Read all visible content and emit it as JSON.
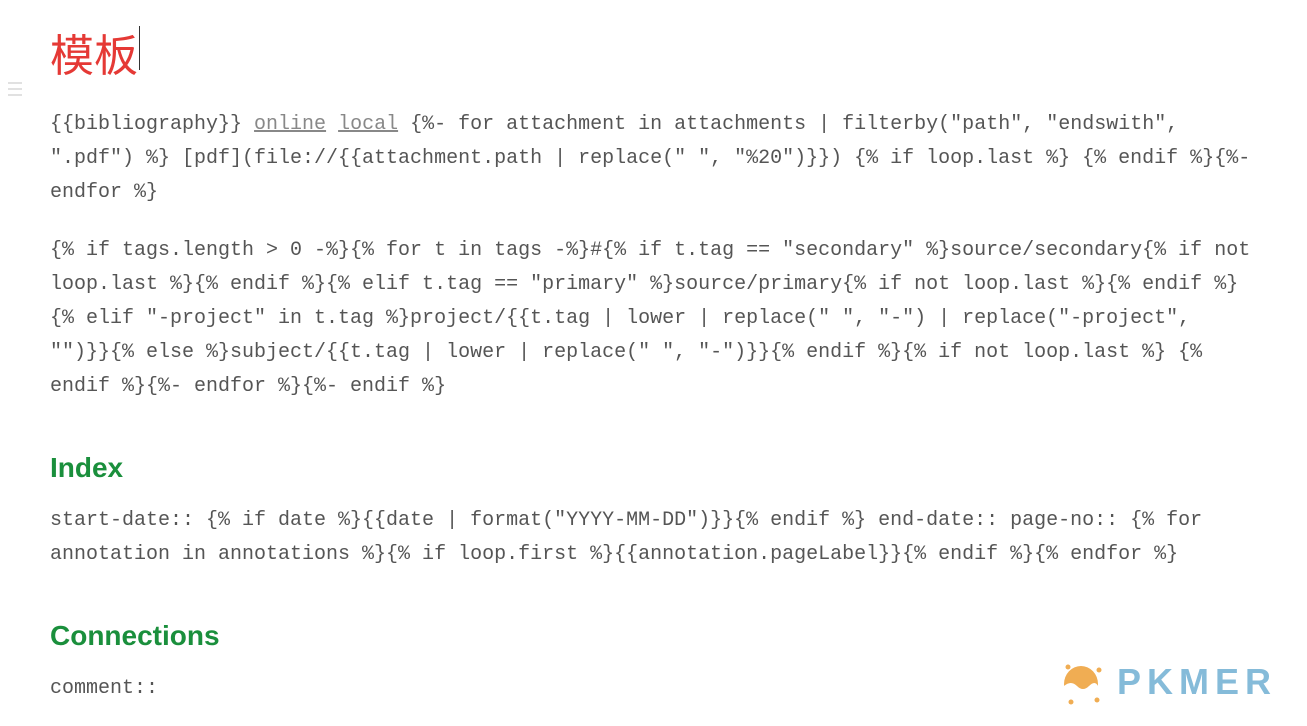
{
  "title": "模板",
  "paragraph1": {
    "prefix": "{{bibliography}} ",
    "link_online": "online",
    "link_local": "local",
    "rest": " {%- for attachment in attachments | filterby(\"path\", \"endswith\", \".pdf\") %} [pdf](file://{{attachment.path | replace(\" \", \"%20\")}}) {% if loop.last %} {% endif %}{%- endfor %}"
  },
  "paragraph2": "{% if tags.length > 0 -%}{% for t in tags -%}#{% if t.tag == \"secondary\" %}source/secondary{% if not loop.last %}{% endif %}{% elif t.tag == \"primary\" %}source/primary{% if not loop.last %}{% endif %}{% elif \"-project\" in t.tag %}project/{{t.tag | lower | replace(\" \", \"-\") | replace(\"-project\", \"\")}}{% else %}subject/{{t.tag | lower | replace(\" \", \"-\")}}{% endif %}{% if not loop.last %} {% endif %}{%- endfor %}{%- endif %}",
  "heading_index": "Index",
  "paragraph3": "start-date:: {% if date %}{{date | format(\"YYYY-MM-DD\")}}{% endif %} end-date:: page-no:: {% for annotation in annotations %}{% if loop.first %}{{annotation.pageLabel}}{% endif %}{% endfor %}",
  "heading_connections": "Connections",
  "paragraph4": "comment::",
  "watermark": "PKMER"
}
